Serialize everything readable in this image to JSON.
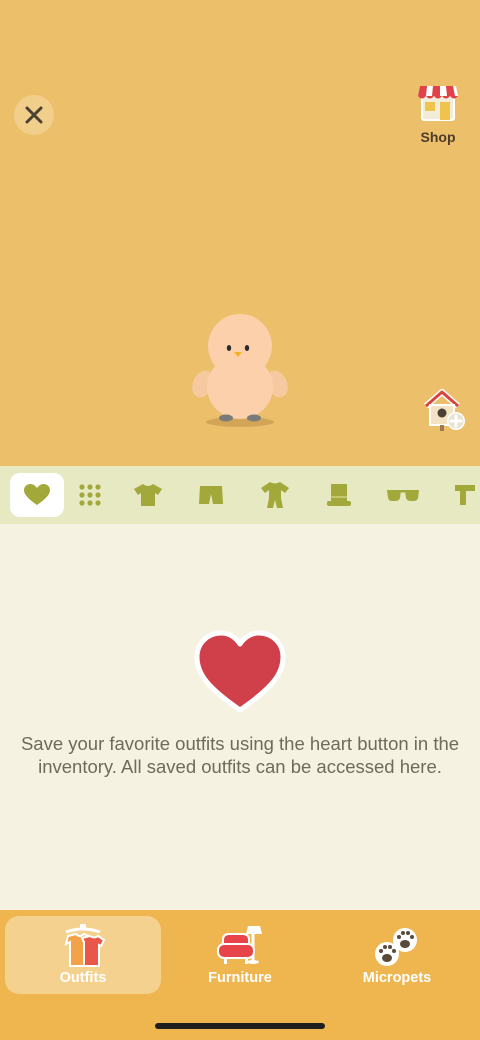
{
  "header": {
    "close_icon": "close-icon",
    "shop_label": "Shop",
    "shop_icon": "shop-storefront-icon",
    "home_add_icon": "birdhouse-add-icon"
  },
  "categories": [
    {
      "name": "favorites",
      "icon": "heart-icon",
      "active": true
    },
    {
      "name": "all",
      "icon": "grid-dots-icon",
      "active": false
    },
    {
      "name": "shirts",
      "icon": "tshirt-icon",
      "active": false
    },
    {
      "name": "pants",
      "icon": "shorts-icon",
      "active": false
    },
    {
      "name": "onesies",
      "icon": "onesie-icon",
      "active": false
    },
    {
      "name": "hats",
      "icon": "top-hat-icon",
      "active": false
    },
    {
      "name": "glasses",
      "icon": "sunglasses-icon",
      "active": false
    },
    {
      "name": "scarves",
      "icon": "scarf-icon",
      "active": false
    }
  ],
  "favorites": {
    "message": "Save your favorite outfits using the heart button in the inventory. All saved outfits can be accessed here."
  },
  "tabs": [
    {
      "label": "Outfits",
      "icon": "outfits-clothes-rack-icon",
      "active": true
    },
    {
      "label": "Furniture",
      "icon": "furniture-armchair-icon",
      "active": false
    },
    {
      "label": "Micropets",
      "icon": "micropets-paws-icon",
      "active": false
    }
  ],
  "colors": {
    "stage_bg": "#ecbf6b",
    "category_bar": "#e6e9c2",
    "category_icon": "#a3a83a",
    "content_bg": "#f5f2e1",
    "heart_red": "#d0404a",
    "tabbar_bg": "#efb650"
  }
}
